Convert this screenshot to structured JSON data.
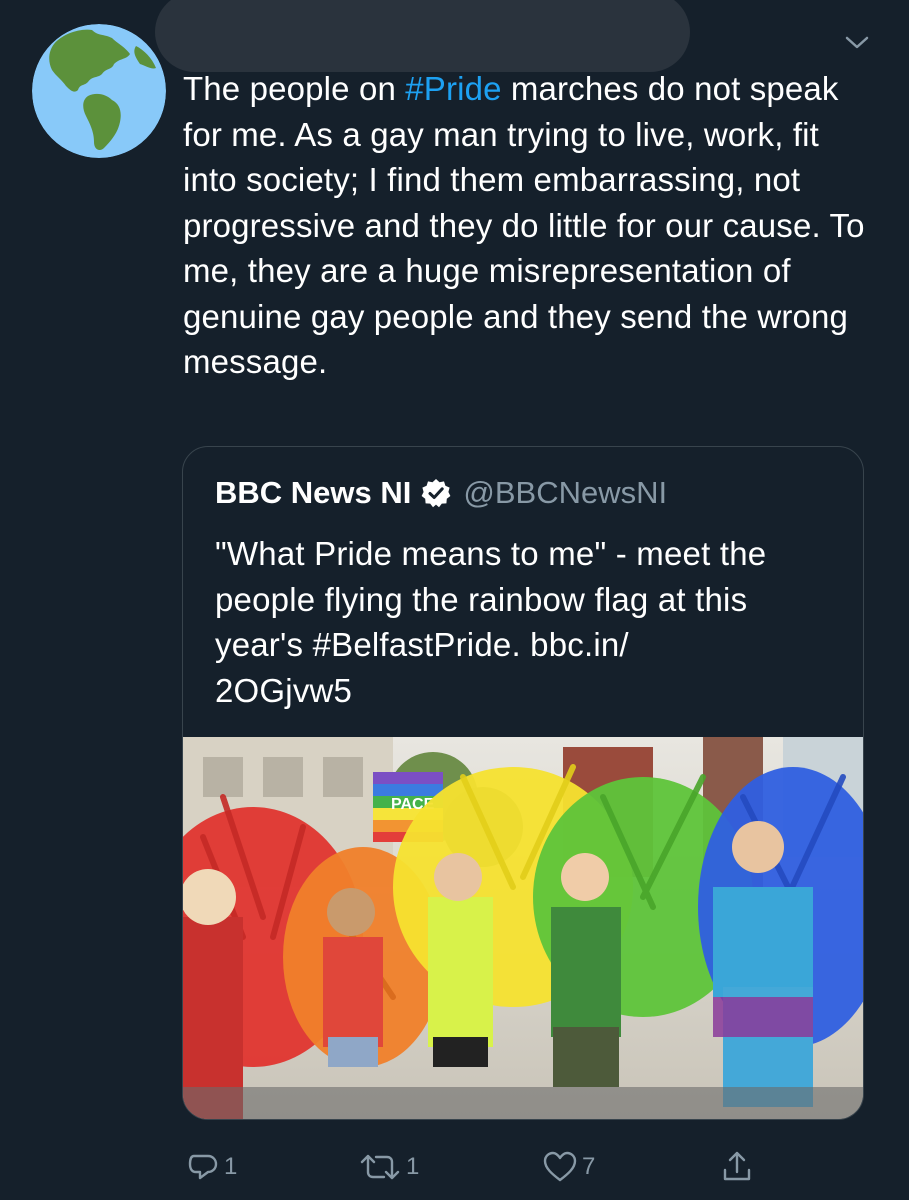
{
  "tweet": {
    "text_before": "The people on ",
    "hashtag": "#Pride",
    "text_after": " marches do not speak for me. As a gay man trying to live, work, fit into society; I find them embarrassing, not progressive and they do little for our cause. To me, they are a huge misrepresentation of genuine gay people and they send the wrong message."
  },
  "quote": {
    "name": "BBC News NI",
    "handle": "@BBCNewsNI",
    "text_line1": "\"What Pride means to me\" - meet the",
    "text_line2": "people flying the rainbow flag at this",
    "text_line3": "year's #BelfastPride.  bbc.in/",
    "text_line4": "2OGjvw5",
    "image_flag_text": "PACE"
  },
  "actions": {
    "replies": "1",
    "retweets": "1",
    "likes": "7"
  },
  "icons": {
    "avatar": "globe-americas-icon",
    "menu": "chevron-down-icon",
    "verified": "verified-badge-icon",
    "reply": "reply-icon",
    "retweet": "retweet-icon",
    "like": "heart-icon",
    "share": "share-icon"
  },
  "colors": {
    "background": "#15202b",
    "accent": "#1da1f2",
    "muted": "#8899a6",
    "border": "#38444d"
  }
}
